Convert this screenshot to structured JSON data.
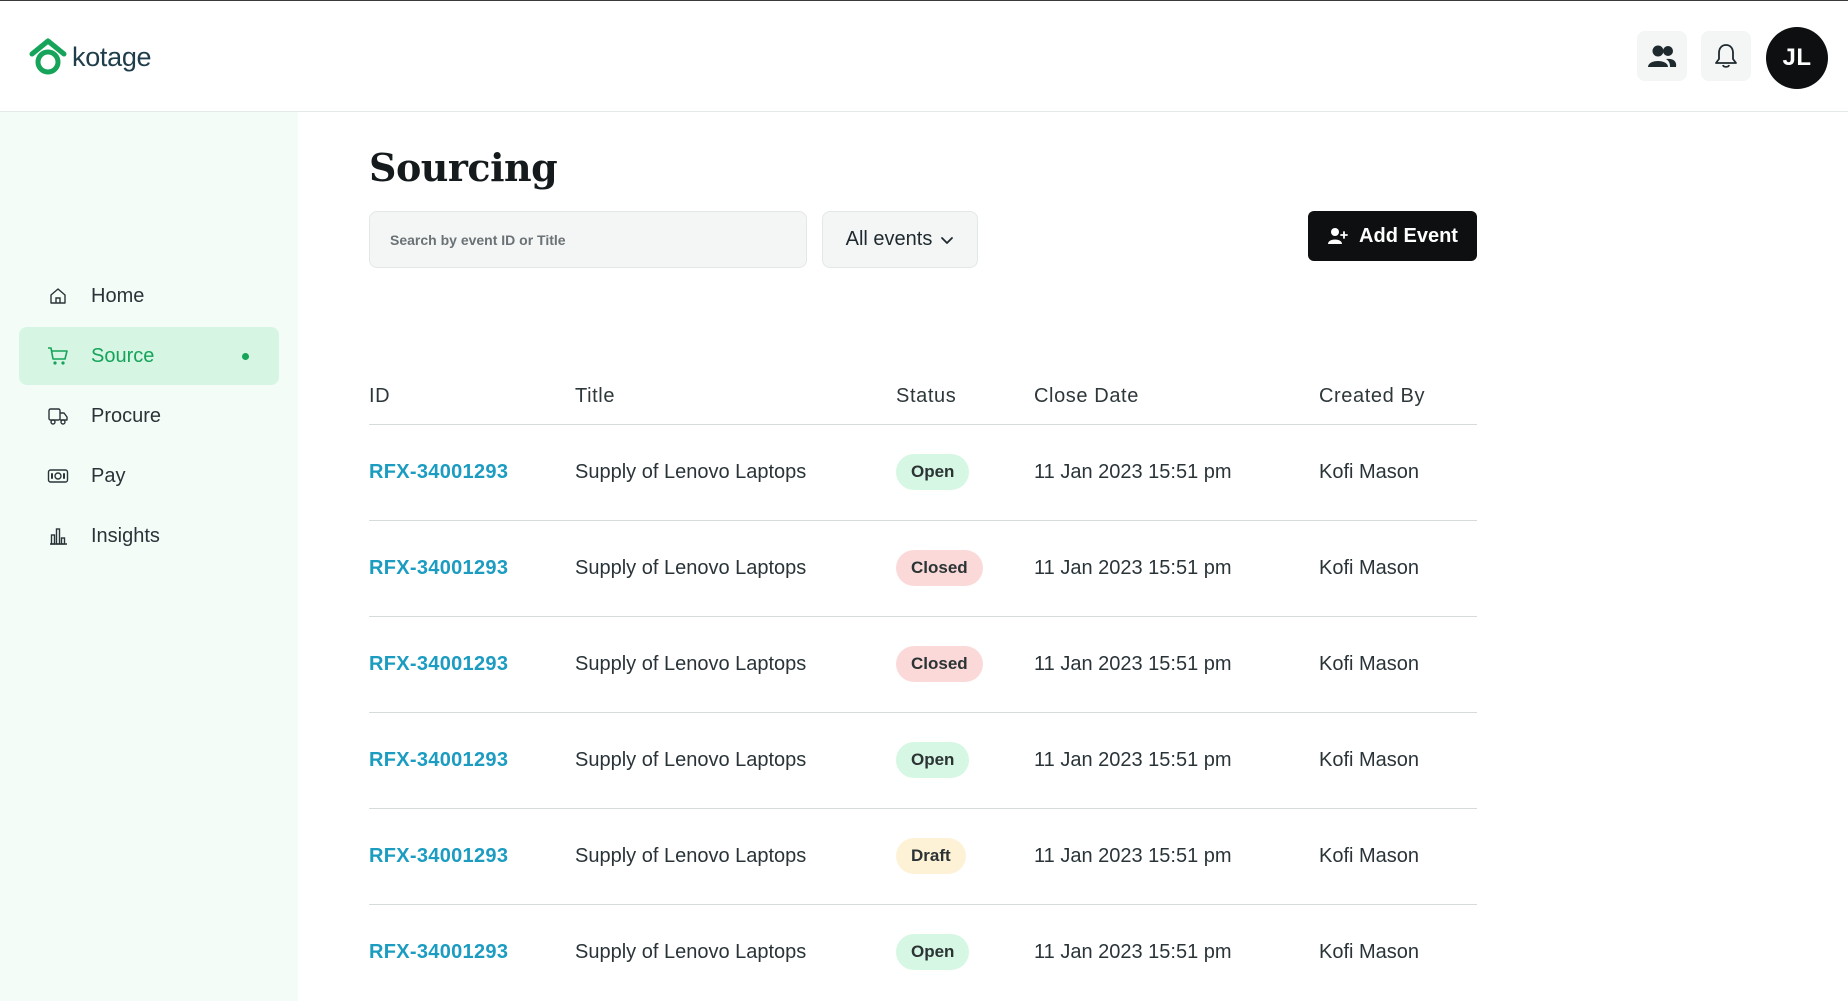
{
  "brand": {
    "name": "kotage",
    "accent": "#16a35a"
  },
  "header": {
    "team_icon": "people-icon",
    "notification_icon": "bell-icon",
    "avatar_initials": "JL"
  },
  "sidebar": {
    "items": [
      {
        "label": "Home",
        "icon": "home-icon",
        "active": false
      },
      {
        "label": "Source",
        "icon": "cart-icon",
        "active": true
      },
      {
        "label": "Procure",
        "icon": "truck-icon",
        "active": false
      },
      {
        "label": "Pay",
        "icon": "money-icon",
        "active": false
      },
      {
        "label": "Insights",
        "icon": "bar-chart-icon",
        "active": false
      }
    ]
  },
  "main": {
    "title": "Sourcing",
    "search": {
      "placeholder": "Search by event ID or Title",
      "value": ""
    },
    "filter": {
      "selected": "All events"
    },
    "add_button": "Add Event"
  },
  "table": {
    "columns": [
      "ID",
      "Title",
      "Status",
      "Close Date",
      "Created By"
    ],
    "rows": [
      {
        "id": "RFX-34001293",
        "title": "Supply of Lenovo Laptops",
        "status": "Open",
        "close_date": "11 Jan 2023 15:51 pm",
        "created_by": "Kofi Mason"
      },
      {
        "id": "RFX-34001293",
        "title": "Supply of Lenovo Laptops",
        "status": "Closed",
        "close_date": "11 Jan 2023 15:51 pm",
        "created_by": "Kofi Mason"
      },
      {
        "id": "RFX-34001293",
        "title": "Supply of Lenovo Laptops",
        "status": "Closed",
        "close_date": "11 Jan 2023 15:51 pm",
        "created_by": "Kofi Mason"
      },
      {
        "id": "RFX-34001293",
        "title": "Supply of Lenovo Laptops",
        "status": "Open",
        "close_date": "11 Jan 2023 15:51 pm",
        "created_by": "Kofi Mason"
      },
      {
        "id": "RFX-34001293",
        "title": "Supply of Lenovo Laptops",
        "status": "Draft",
        "close_date": "11 Jan 2023 15:51 pm",
        "created_by": "Kofi Mason"
      },
      {
        "id": "RFX-34001293",
        "title": "Supply of Lenovo Laptops",
        "status": "Open",
        "close_date": "11 Jan 2023 15:51 pm",
        "created_by": "Kofi Mason"
      }
    ]
  }
}
